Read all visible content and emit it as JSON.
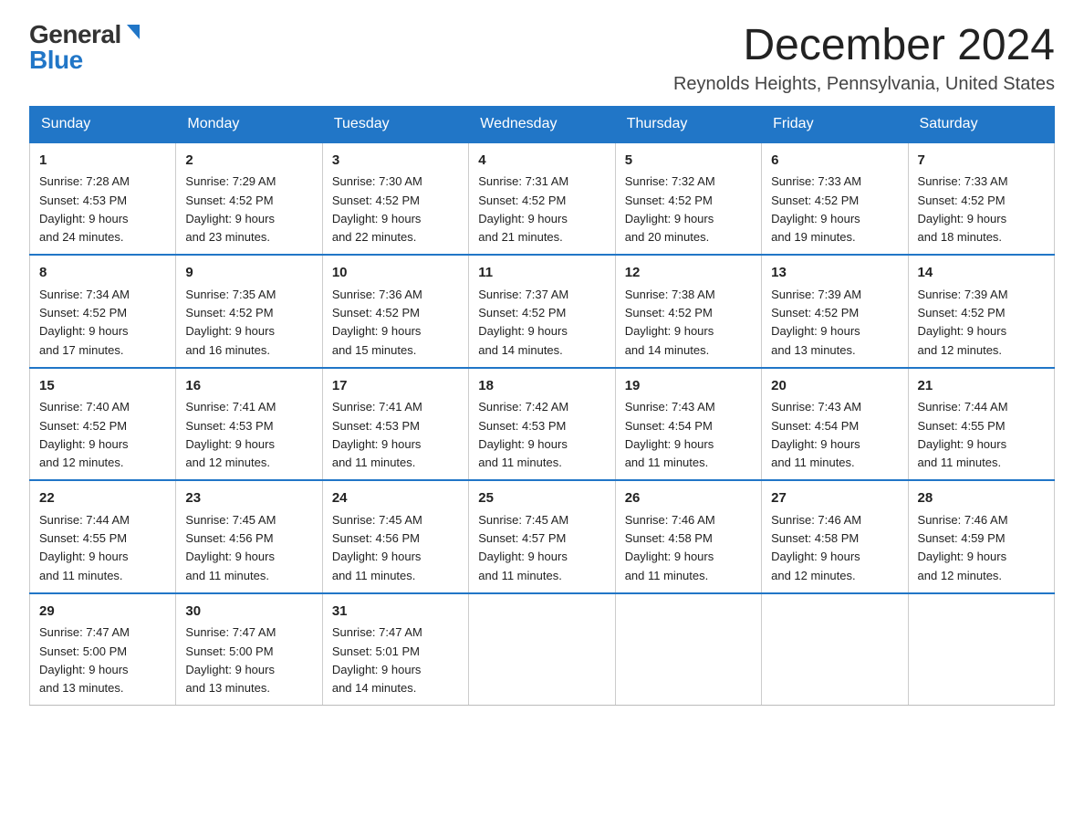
{
  "header": {
    "logo_general": "General",
    "logo_blue": "Blue",
    "month_title": "December 2024",
    "location": "Reynolds Heights, Pennsylvania, United States"
  },
  "weekdays": [
    "Sunday",
    "Monday",
    "Tuesday",
    "Wednesday",
    "Thursday",
    "Friday",
    "Saturday"
  ],
  "weeks": [
    [
      {
        "day": "1",
        "sunrise": "7:28 AM",
        "sunset": "4:53 PM",
        "daylight": "9 hours and 24 minutes."
      },
      {
        "day": "2",
        "sunrise": "7:29 AM",
        "sunset": "4:52 PM",
        "daylight": "9 hours and 23 minutes."
      },
      {
        "day": "3",
        "sunrise": "7:30 AM",
        "sunset": "4:52 PM",
        "daylight": "9 hours and 22 minutes."
      },
      {
        "day": "4",
        "sunrise": "7:31 AM",
        "sunset": "4:52 PM",
        "daylight": "9 hours and 21 minutes."
      },
      {
        "day": "5",
        "sunrise": "7:32 AM",
        "sunset": "4:52 PM",
        "daylight": "9 hours and 20 minutes."
      },
      {
        "day": "6",
        "sunrise": "7:33 AM",
        "sunset": "4:52 PM",
        "daylight": "9 hours and 19 minutes."
      },
      {
        "day": "7",
        "sunrise": "7:33 AM",
        "sunset": "4:52 PM",
        "daylight": "9 hours and 18 minutes."
      }
    ],
    [
      {
        "day": "8",
        "sunrise": "7:34 AM",
        "sunset": "4:52 PM",
        "daylight": "9 hours and 17 minutes."
      },
      {
        "day": "9",
        "sunrise": "7:35 AM",
        "sunset": "4:52 PM",
        "daylight": "9 hours and 16 minutes."
      },
      {
        "day": "10",
        "sunrise": "7:36 AM",
        "sunset": "4:52 PM",
        "daylight": "9 hours and 15 minutes."
      },
      {
        "day": "11",
        "sunrise": "7:37 AM",
        "sunset": "4:52 PM",
        "daylight": "9 hours and 14 minutes."
      },
      {
        "day": "12",
        "sunrise": "7:38 AM",
        "sunset": "4:52 PM",
        "daylight": "9 hours and 14 minutes."
      },
      {
        "day": "13",
        "sunrise": "7:39 AM",
        "sunset": "4:52 PM",
        "daylight": "9 hours and 13 minutes."
      },
      {
        "day": "14",
        "sunrise": "7:39 AM",
        "sunset": "4:52 PM",
        "daylight": "9 hours and 12 minutes."
      }
    ],
    [
      {
        "day": "15",
        "sunrise": "7:40 AM",
        "sunset": "4:52 PM",
        "daylight": "9 hours and 12 minutes."
      },
      {
        "day": "16",
        "sunrise": "7:41 AM",
        "sunset": "4:53 PM",
        "daylight": "9 hours and 12 minutes."
      },
      {
        "day": "17",
        "sunrise": "7:41 AM",
        "sunset": "4:53 PM",
        "daylight": "9 hours and 11 minutes."
      },
      {
        "day": "18",
        "sunrise": "7:42 AM",
        "sunset": "4:53 PM",
        "daylight": "9 hours and 11 minutes."
      },
      {
        "day": "19",
        "sunrise": "7:43 AM",
        "sunset": "4:54 PM",
        "daylight": "9 hours and 11 minutes."
      },
      {
        "day": "20",
        "sunrise": "7:43 AM",
        "sunset": "4:54 PM",
        "daylight": "9 hours and 11 minutes."
      },
      {
        "day": "21",
        "sunrise": "7:44 AM",
        "sunset": "4:55 PM",
        "daylight": "9 hours and 11 minutes."
      }
    ],
    [
      {
        "day": "22",
        "sunrise": "7:44 AM",
        "sunset": "4:55 PM",
        "daylight": "9 hours and 11 minutes."
      },
      {
        "day": "23",
        "sunrise": "7:45 AM",
        "sunset": "4:56 PM",
        "daylight": "9 hours and 11 minutes."
      },
      {
        "day": "24",
        "sunrise": "7:45 AM",
        "sunset": "4:56 PM",
        "daylight": "9 hours and 11 minutes."
      },
      {
        "day": "25",
        "sunrise": "7:45 AM",
        "sunset": "4:57 PM",
        "daylight": "9 hours and 11 minutes."
      },
      {
        "day": "26",
        "sunrise": "7:46 AM",
        "sunset": "4:58 PM",
        "daylight": "9 hours and 11 minutes."
      },
      {
        "day": "27",
        "sunrise": "7:46 AM",
        "sunset": "4:58 PM",
        "daylight": "9 hours and 12 minutes."
      },
      {
        "day": "28",
        "sunrise": "7:46 AM",
        "sunset": "4:59 PM",
        "daylight": "9 hours and 12 minutes."
      }
    ],
    [
      {
        "day": "29",
        "sunrise": "7:47 AM",
        "sunset": "5:00 PM",
        "daylight": "9 hours and 13 minutes."
      },
      {
        "day": "30",
        "sunrise": "7:47 AM",
        "sunset": "5:00 PM",
        "daylight": "9 hours and 13 minutes."
      },
      {
        "day": "31",
        "sunrise": "7:47 AM",
        "sunset": "5:01 PM",
        "daylight": "9 hours and 14 minutes."
      },
      null,
      null,
      null,
      null
    ]
  ],
  "labels": {
    "sunrise": "Sunrise:",
    "sunset": "Sunset:",
    "daylight": "Daylight:"
  }
}
